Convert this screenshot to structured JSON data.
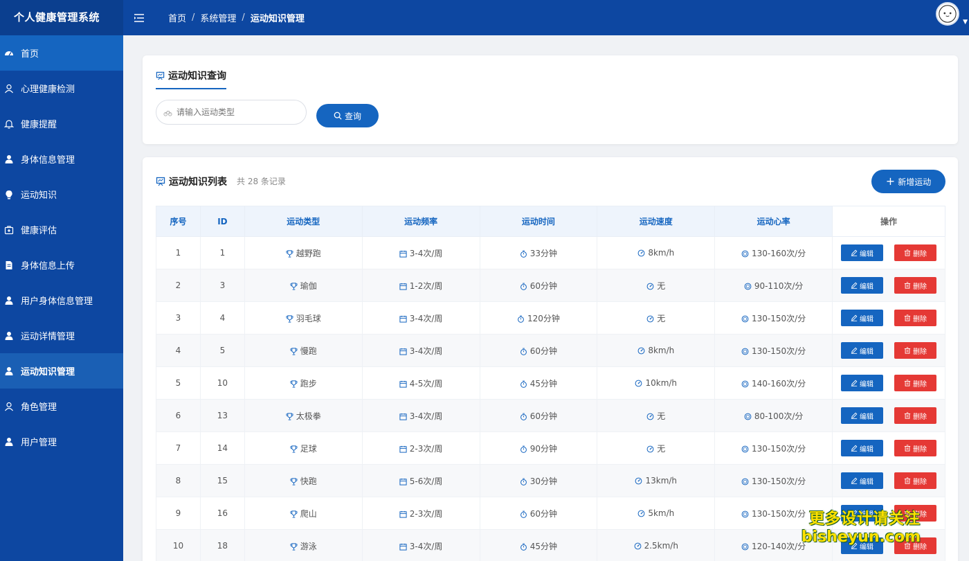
{
  "app": {
    "title": "个人健康管理系统"
  },
  "sidebar": {
    "items": [
      {
        "label": "首页",
        "icon": "dashboard-icon"
      },
      {
        "label": "心理健康检测",
        "icon": "user-icon"
      },
      {
        "label": "健康提醒",
        "icon": "bell-icon"
      },
      {
        "label": "身体信息管理",
        "icon": "user-solid-icon"
      },
      {
        "label": "运动知识",
        "icon": "bulb-icon"
      },
      {
        "label": "健康评估",
        "icon": "first-aid-icon"
      },
      {
        "label": "身体信息上传",
        "icon": "document-icon"
      },
      {
        "label": "用户身体信息管理",
        "icon": "user-solid-icon"
      },
      {
        "label": "运动详情管理",
        "icon": "user-solid-icon"
      },
      {
        "label": "运动知识管理",
        "icon": "user-solid-icon"
      },
      {
        "label": "角色管理",
        "icon": "user-icon"
      },
      {
        "label": "用户管理",
        "icon": "user-solid-icon"
      }
    ]
  },
  "breadcrumb": {
    "home": "首页",
    "parent": "系统管理",
    "current": "运动知识管理",
    "sep": "/"
  },
  "query": {
    "title": "运动知识查询",
    "placeholder": "请输入运动类型",
    "button": "查询"
  },
  "list": {
    "title": "运动知识列表",
    "count": "共 28 条记录",
    "add_button": "新增运动",
    "headers": {
      "index": "序号",
      "id": "ID",
      "type": "运动类型",
      "freq": "运动频率",
      "time": "运动时间",
      "speed": "运动速度",
      "heart": "运动心率",
      "op": "操作"
    },
    "edit_label": "编辑",
    "delete_label": "删除",
    "rows": [
      {
        "index": "1",
        "id": "1",
        "type": "越野跑",
        "freq": "3-4次/周",
        "time": "33分钟",
        "speed": "8km/h",
        "heart": "130-160次/分"
      },
      {
        "index": "2",
        "id": "3",
        "type": "瑜伽",
        "freq": "1-2次/周",
        "time": "60分钟",
        "speed": "无",
        "heart": "90-110次/分"
      },
      {
        "index": "3",
        "id": "4",
        "type": "羽毛球",
        "freq": "3-4次/周",
        "time": "120分钟",
        "speed": "无",
        "heart": "130-150次/分"
      },
      {
        "index": "4",
        "id": "5",
        "type": "慢跑",
        "freq": "3-4次/周",
        "time": "60分钟",
        "speed": "8km/h",
        "heart": "130-150次/分"
      },
      {
        "index": "5",
        "id": "10",
        "type": "跑步",
        "freq": "4-5次/周",
        "time": "45分钟",
        "speed": "10km/h",
        "heart": "140-160次/分"
      },
      {
        "index": "6",
        "id": "13",
        "type": "太极拳",
        "freq": "3-4次/周",
        "time": "60分钟",
        "speed": "无",
        "heart": "80-100次/分"
      },
      {
        "index": "7",
        "id": "14",
        "type": "足球",
        "freq": "2-3次/周",
        "time": "90分钟",
        "speed": "无",
        "heart": "130-150次/分"
      },
      {
        "index": "8",
        "id": "15",
        "type": "快跑",
        "freq": "5-6次/周",
        "time": "30分钟",
        "speed": "13km/h",
        "heart": "130-150次/分"
      },
      {
        "index": "9",
        "id": "16",
        "type": "爬山",
        "freq": "2-3次/周",
        "time": "60分钟",
        "speed": "5km/h",
        "heart": "130-150次/分"
      },
      {
        "index": "10",
        "id": "18",
        "type": "游泳",
        "freq": "3-4次/周",
        "time": "45分钟",
        "speed": "2.5km/h",
        "heart": "120-140次/分"
      }
    ]
  },
  "watermark": {
    "line1": "更多设计请关注",
    "line2": "bisheyun.com"
  },
  "colors": {
    "primary": "#1565c0",
    "sidebar": "#0d47a1",
    "danger": "#e53935"
  }
}
